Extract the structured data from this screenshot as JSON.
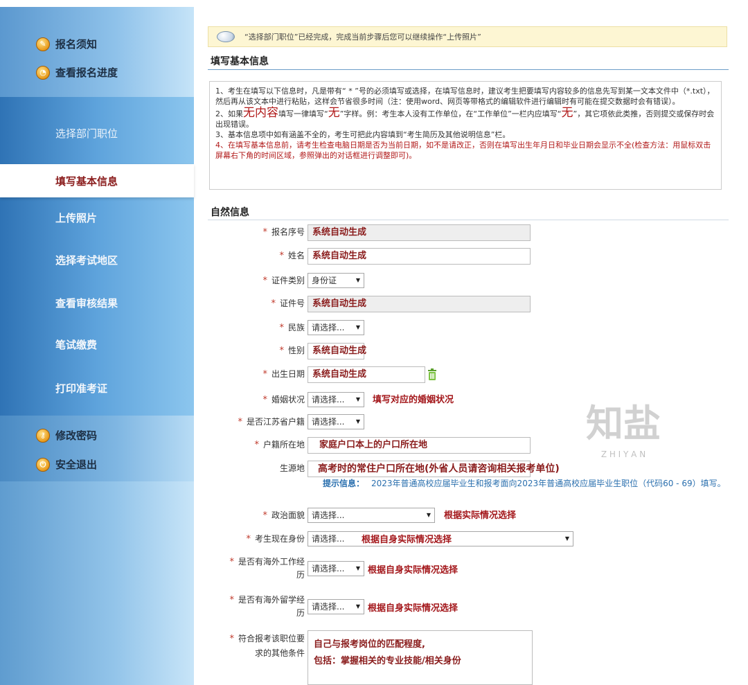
{
  "sidebar": {
    "top_links": [
      {
        "label": "报名须知",
        "icon": "info-icon"
      },
      {
        "label": "查看报名进度",
        "icon": "clock-icon"
      }
    ],
    "steps": [
      {
        "label": "选择部门职位"
      },
      {
        "label": "填写基本信息",
        "active": true
      },
      {
        "label": "上传照片"
      },
      {
        "label": "选择考试地区"
      },
      {
        "label": "查看审核结果"
      },
      {
        "label": "笔试缴费"
      },
      {
        "label": "打印准考证"
      }
    ],
    "bottom_links": [
      {
        "label": "修改密码",
        "icon": "key-icon"
      },
      {
        "label": "安全退出",
        "icon": "exit-icon"
      }
    ]
  },
  "notice": "“选择部门职位”已经完成，完成当前步骤后您可以继续操作“上传照片”",
  "section_basic": "填写基本信息",
  "instructions": {
    "p1": "1、考生在填写以下信息时，凡是带有“ * ”号的必须填写或选择，在填写信息时，建议考生把要填写内容较多的信息先写到某一文本文件中（*.txt），然后再从该文本中进行粘贴，这样会节省很多时间（注：使用word、网页等带格式的编辑软件进行编辑时有可能在提交数据时会有错误）。",
    "p2_a": "2、如果",
    "p2_big1": "无内容",
    "p2_b": "填写一律填写“",
    "p2_big2": "无",
    "p2_c": "”字样。例：考生本人没有工作单位，在“工作单位”一栏内应填写“",
    "p2_big3": "无",
    "p2_d": "”，其它项依此类推，否则提交或保存时会出现错误。",
    "p3": "3、基本信息项中如有涵盖不全的，考生可把此内容填到“考生简历及其他说明信息”栏。",
    "p4": "4、在填写基本信息前，请考生检查电脑日期是否为当前日期，如不是请改正，否则在填写出生年月日和毕业日期会显示不全(检查方法：用鼠标双击屏幕右下角的时间区域，参照弹出的对话框进行调整即可)。"
  },
  "section_natural": "自然信息",
  "star": "*",
  "form": {
    "reg_no": {
      "label": "报名序号",
      "value": "系统自动生成"
    },
    "name": {
      "label": "姓名",
      "value": "系统自动生成"
    },
    "id_type": {
      "label": "证件类别",
      "value": "身份证"
    },
    "id_no": {
      "label": "证件号",
      "value": "系统自动生成"
    },
    "ethnicity": {
      "label": "民族",
      "value": "请选择..."
    },
    "gender": {
      "label": "性别",
      "value": "系统自动生成"
    },
    "birth": {
      "label": "出生日期",
      "value": "系统自动生成"
    },
    "marital": {
      "label": "婚姻状况",
      "value": "请选择...",
      "hint": "填写对应的婚姻状况"
    },
    "jiangsu": {
      "label": "是否江苏省户籍",
      "value": "请选择..."
    },
    "hukou": {
      "label": "户籍所在地",
      "value": "家庭户口本上的户口所在地"
    },
    "origin": {
      "label": "生源地",
      "value": "高考时的常住户口所在地(外省人员请咨询相关报考单位)"
    },
    "tip_label": "提示信息：",
    "tip_text": "2023年普通高校应届毕业生和报考面向2023年普通高校应届毕业生职位（代码60 - 69）填写。",
    "political": {
      "label": "政治面貌",
      "value": "请选择...",
      "hint": "根据实际情况选择"
    },
    "identity": {
      "label": "考生现在身份",
      "value": "请选择...",
      "hint": "根据自身实际情况选择"
    },
    "overseas_work": {
      "label": "是否有海外工作经历",
      "value": "请选择...",
      "hint": "根据自身实际情况选择"
    },
    "overseas_study": {
      "label": "是否有海外留学经历",
      "value": "请选择...",
      "hint": "根据自身实际情况选择"
    },
    "other_cond": {
      "label": "符合报考该职位要求的其他条件",
      "line1": "自己与报考岗位的匹配程度,",
      "line2": "包括：掌握相关的专业技能/相关身份"
    }
  },
  "watermark": {
    "text": "知盐",
    "sub": "Z H I Y A N"
  }
}
